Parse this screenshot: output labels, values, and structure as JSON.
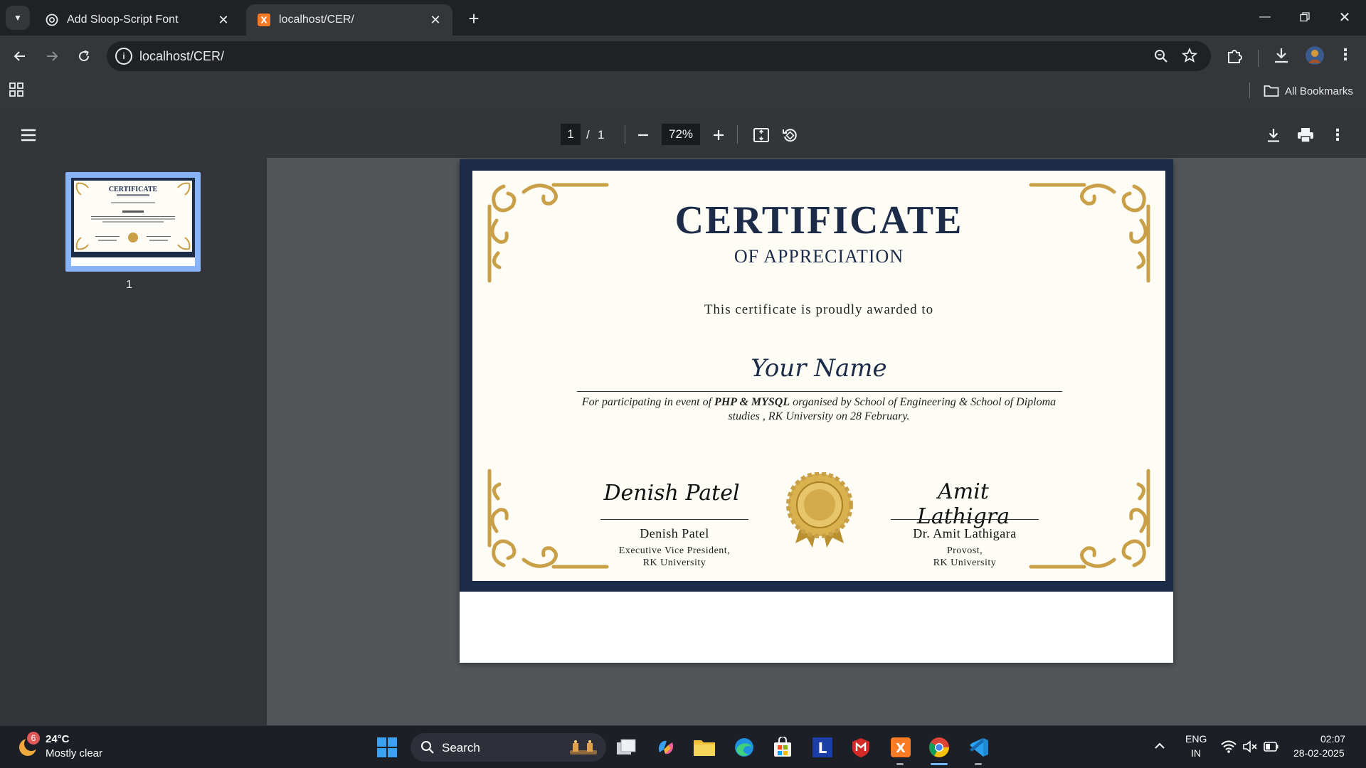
{
  "browser": {
    "tabs": [
      {
        "title": "Add Sloop-Script Font",
        "favicon": "chatgpt-icon",
        "active": false
      },
      {
        "title": "localhost/CER/",
        "favicon": "xampp-icon",
        "active": true
      }
    ],
    "url": "localhost/CER/",
    "bookmarks_label": "All Bookmarks"
  },
  "pdf_toolbar": {
    "current_page": "1",
    "separator": "/",
    "total_pages": "1",
    "zoom": "72%"
  },
  "sidebar": {
    "thumbnails": [
      {
        "page_label": "1"
      }
    ]
  },
  "certificate": {
    "heading": "CERTIFICATE",
    "subheading": "OF APPRECIATION",
    "awarded_text": "This certificate is proudly awarded to",
    "recipient": "Your Name",
    "description_pre": "For participating in event of ",
    "event": "PHP & MYSQL",
    "description_post": " organised by School of Engineering & School of Diploma studies , RK University on 28 February.",
    "signatories": [
      {
        "signature": "Denish Patel",
        "name": "Denish Patel",
        "role_line1": "Executive Vice President,",
        "role_line2": "RK University"
      },
      {
        "signature": "Amit Lathigra",
        "name": "Dr. Amit Lathigara",
        "role_line1": "Provost,",
        "role_line2": "RK University"
      }
    ],
    "colors": {
      "navy": "#1c2b47",
      "gold": "#c9a048",
      "paper": "#fdfcf5"
    }
  },
  "taskbar": {
    "weather_temp": "24°C",
    "weather_desc": "Mostly clear",
    "weather_badge": "6",
    "search_label": "Search",
    "lang_line1": "ENG",
    "lang_line2": "IN",
    "time": "02:07",
    "date": "28-02-2025"
  }
}
